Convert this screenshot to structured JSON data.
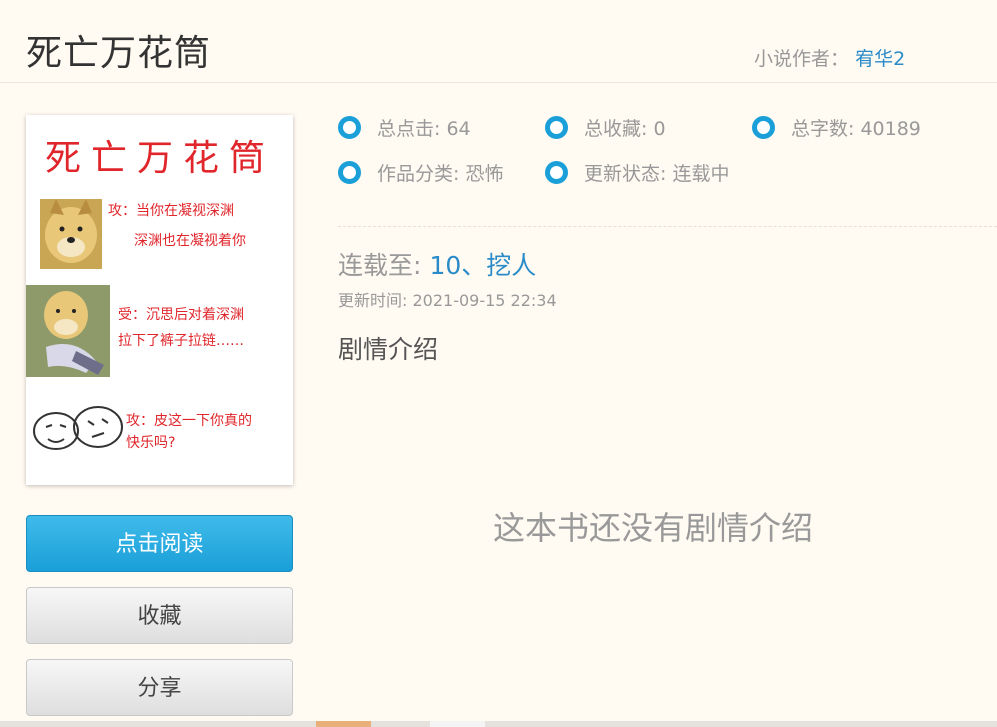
{
  "book": {
    "title": "死亡万花筒",
    "author_label": "小说作者：",
    "author_name": "宥华2"
  },
  "cover": {
    "title": "死亡万花筒",
    "panels": [
      {
        "line1": "攻：当你在凝视深渊",
        "line2": "深渊也在凝视着你"
      },
      {
        "line1": "受：沉思后对着深渊",
        "line2": "拉下了裤子拉链……"
      },
      {
        "line1": "攻：皮这一下你真的",
        "line2": "快乐吗?"
      }
    ]
  },
  "stats": [
    {
      "label": "总点击: 64"
    },
    {
      "label": "总收藏: 0"
    },
    {
      "label": "总字数: 40189"
    },
    {
      "label": "作品分类: 恐怖"
    },
    {
      "label": "更新状态: 连载中"
    }
  ],
  "latest": {
    "label": "连载至:",
    "chapter": "10、挖人",
    "update_time": "更新时间: 2021-09-15 22:34"
  },
  "intro": {
    "heading": "剧情介绍",
    "empty_text": "这本书还没有剧情介绍"
  },
  "buttons": {
    "read": "点击阅读",
    "collect": "收藏",
    "share": "分享"
  },
  "colors": {
    "accent": "#1a9fd8",
    "link": "#2a8bc9",
    "background": "#fffaf2",
    "cover_text": "#e0262b"
  }
}
